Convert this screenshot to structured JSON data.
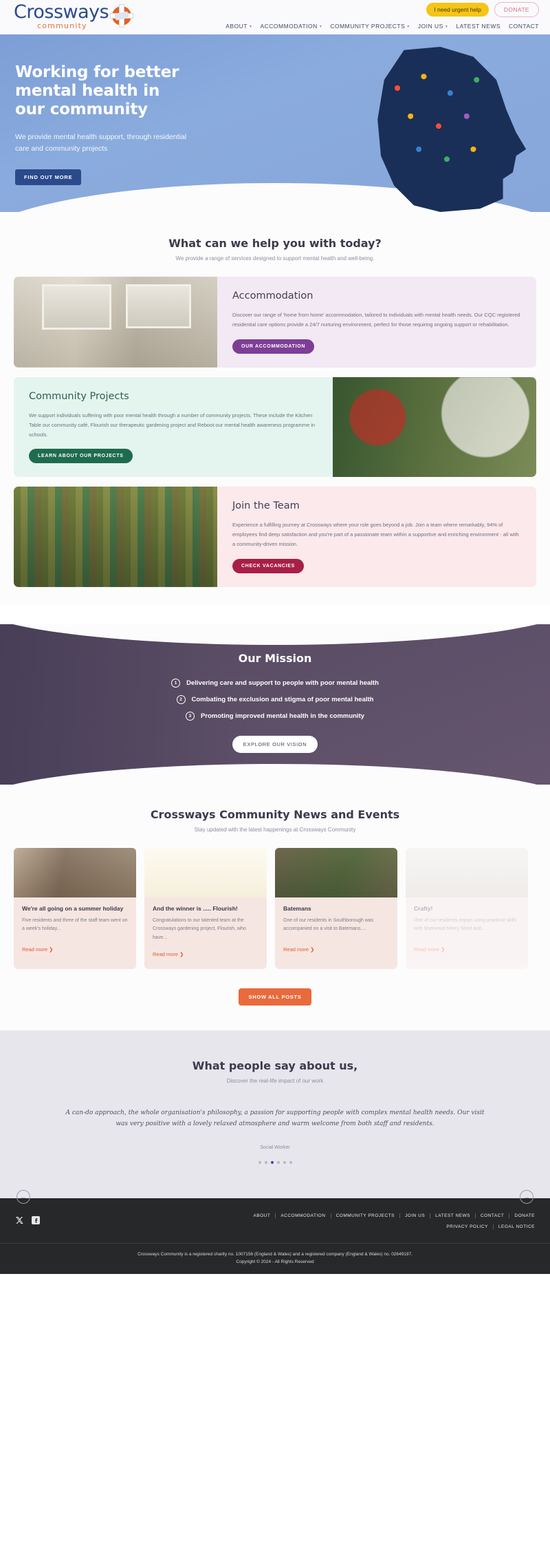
{
  "header": {
    "logo": {
      "main": "Crossways",
      "sub": "community"
    },
    "urgent_button": "I need urgent help",
    "donate_button": "DONATE",
    "nav": [
      {
        "label": "ABOUT",
        "has_caret": true
      },
      {
        "label": "ACCOMMODATION",
        "has_caret": true
      },
      {
        "label": "COMMUNITY PROJECTS",
        "has_caret": true
      },
      {
        "label": "JOIN US",
        "has_caret": true
      },
      {
        "label": "LATEST NEWS",
        "has_caret": false
      },
      {
        "label": "CONTACT",
        "has_caret": false
      }
    ]
  },
  "hero": {
    "title": "Working for better mental health in our community",
    "subtitle": "We provide mental health support, through residential care and community projects",
    "cta": "FIND OUT MORE"
  },
  "services": {
    "title": "What can we help you with today?",
    "subtitle": "We provide a range of services designed to support mental health and well-being.",
    "cards": [
      {
        "heading": "Accommodation",
        "body": "Discover our range of 'home from home' accommodation, tailored to individuals with mental health needs. Our CQC registered residential care options provide a 24/7 nurturing environment, perfect for those requiring ongoing support or rehabilitation.",
        "button": "OUR ACCOMMODATION"
      },
      {
        "heading": "Community Projects",
        "body": "We support individuals suffering with poor mental health through a number of community projects. These include the Kitchen Table our community café, Flourish our therapeutic gardening project and Reboot our mental health awareness programme in schools.",
        "button": "LEARN ABOUT OUR PROJECTS"
      },
      {
        "heading": "Join the Team",
        "body": "Experience a fulfilling journey at Crossways where your role goes beyond a job. Join a team where remarkably, 94% of employees find deep satisfaction and you're part of a passionate team within a supportive and enriching environment - all with a community-driven mission.",
        "button": "CHECK VACANCIES"
      }
    ]
  },
  "mission": {
    "title": "Our Mission",
    "items": [
      {
        "num": "1",
        "text": "Delivering care and support to people with poor mental health"
      },
      {
        "num": "2",
        "text": "Combating the exclusion and stigma of poor mental health"
      },
      {
        "num": "3",
        "text": "Promoting improved mental health in the community"
      }
    ],
    "cta": "EXPLORE OUR VISION"
  },
  "news": {
    "title": "Crossways Community News and Events",
    "subtitle": "Stay updated with the latest happenings at Crossways Community",
    "prev_arrow": "‹",
    "next_arrow": "›",
    "read_more": "Read more  ❯",
    "cards": [
      {
        "heading": "We're all going on a summer holiday",
        "excerpt": "Five residents and three of the staff team went on a week's holiday..."
      },
      {
        "heading": "And the winner is ..... Flourish!",
        "excerpt": "Congratulations to our talented team at the Crossways gardening project, Flourish, who have..."
      },
      {
        "heading": "Batemans",
        "excerpt": "One of our residents in Southborough was accompanied on a visit to Batemans...."
      },
      {
        "heading": "Crafty!",
        "excerpt": "One of our residents enjoys using practical skills with Sherwood Merry Shed and..."
      }
    ],
    "show_all_button": "SHOW ALL POSTS"
  },
  "testimonials": {
    "title": "What people say about us,",
    "subtitle": "Discover the real-life impact of our work",
    "quote": "A can-do approach, the whole organisation's philosophy, a passion for supporting people with complex mental health needs. Our visit was very positive with a lovely relaxed atmosphere and warm welcome from both staff and residents.",
    "role": "Social Worker",
    "prev_arrow": "←",
    "next_arrow": "→",
    "dot_count": 6,
    "active_dot": 2
  },
  "footer": {
    "links_row1": [
      "ABOUT",
      "ACCOMMODATION",
      "COMMUNITY PROJECTS",
      "JOIN US",
      "LATEST NEWS",
      "CONTACT",
      "DONATE"
    ],
    "links_row2": [
      "PRIVACY POLICY",
      "LEGAL NOTICE"
    ],
    "legal_line1": "Crossways Community is a registered charity no. 1007156 (England & Wales) and a registered company (England & Wales) no. 02649197.",
    "legal_line2": "Copyright © 2024 - All Rights Reserved"
  },
  "colors": {
    "brand_blue": "#2b4a8b",
    "brand_orange": "#e8743b",
    "yellow": "#f5c518",
    "pink": "#d8708a",
    "purple": "#7e3e96",
    "green": "#1f6b50",
    "crimson": "#a81f45",
    "news_accent": "#e96a3c"
  }
}
